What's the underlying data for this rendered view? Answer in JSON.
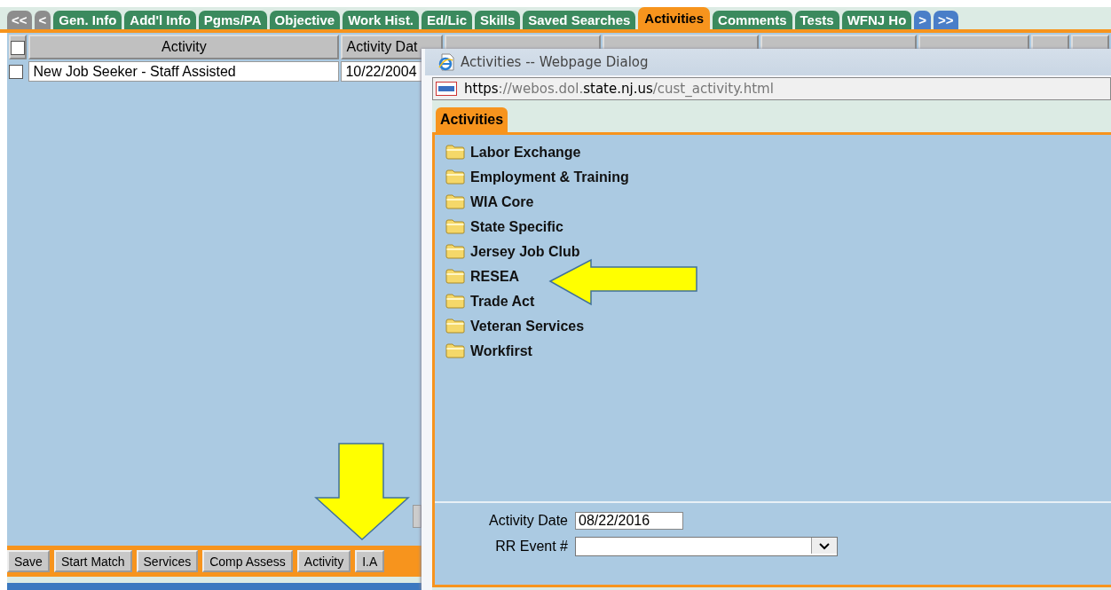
{
  "main_tabs": [
    {
      "label": "<<",
      "kind": "back",
      "selected": false
    },
    {
      "label": "<",
      "kind": "back",
      "selected": false
    },
    {
      "label": "Gen. Info",
      "kind": "tab",
      "selected": false
    },
    {
      "label": "Add'l Info",
      "kind": "tab",
      "selected": false
    },
    {
      "label": "Pgms/PA",
      "kind": "tab",
      "selected": false
    },
    {
      "label": "Objective",
      "kind": "tab",
      "selected": false
    },
    {
      "label": "Work Hist.",
      "kind": "tab",
      "selected": false
    },
    {
      "label": "Ed/Lic",
      "kind": "tab",
      "selected": false
    },
    {
      "label": "Skills",
      "kind": "tab",
      "selected": false
    },
    {
      "label": "Saved Searches",
      "kind": "tab",
      "selected": false
    },
    {
      "label": "Activities",
      "kind": "tab",
      "selected": true
    },
    {
      "label": "Comments",
      "kind": "tab",
      "selected": false
    },
    {
      "label": "Tests",
      "kind": "tab",
      "selected": false
    },
    {
      "label": "WFNJ Ho",
      "kind": "tab",
      "selected": false
    },
    {
      "label": ">",
      "kind": "forward",
      "selected": false
    },
    {
      "label": ">>",
      "kind": "forward",
      "selected": false
    }
  ],
  "table": {
    "select_all_checked": false,
    "columns": [
      "Activity",
      "Activity Dat"
    ],
    "rows": [
      {
        "checked": false,
        "cells": [
          "New Job Seeker - Staff Assisted",
          "10/22/2004"
        ]
      }
    ]
  },
  "buttons": [
    "Save",
    "Start Match",
    "Services",
    "Comp Assess",
    "Activity",
    "I.A"
  ],
  "dialog": {
    "title": "Activities -- Webpage Dialog",
    "url": [
      {
        "text": "https",
        "emphasis": true
      },
      {
        "text": "://webos.dol.",
        "emphasis": false
      },
      {
        "text": "state.nj.us",
        "emphasis": true
      },
      {
        "text": "/cust_activity.html",
        "emphasis": false
      }
    ],
    "tabs": [
      {
        "label": "Activities",
        "selected": true
      }
    ],
    "folders": [
      "Labor Exchange",
      "Employment & Training",
      "WIA Core",
      "State Specific",
      "Jersey Job Club",
      "RESEA",
      "Trade Act",
      "Veteran Services",
      "Workfirst"
    ],
    "activity_date": {
      "label": "Activity Date",
      "value": "08/22/2016"
    },
    "rr_event": {
      "label": "RR Event #"
    }
  },
  "callouts": [
    {
      "kind": "down"
    },
    {
      "kind": "left"
    }
  ]
}
